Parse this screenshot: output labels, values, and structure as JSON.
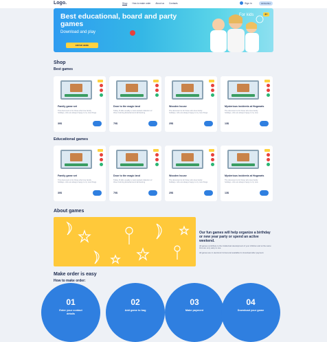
{
  "header": {
    "logo": "Logo.",
    "nav": [
      "Shop",
      "How to make order",
      "About us",
      "Contacts"
    ],
    "signin": "Sign in",
    "lang": "ENGLISH"
  },
  "hero": {
    "title": "Best educational, board and party games",
    "subtitle": "Download and play",
    "button": "ENTER HERE",
    "for_kids": "For kids",
    "age": "6+"
  },
  "shop": {
    "title": "Shop",
    "best_title": "Best games",
    "edu_title": "Educational games",
    "best": [
      {
        "name": "Family game set",
        "desc": "This document is for those who love family holidays, who are always happy to try new things",
        "price": "30$"
      },
      {
        "name": "Door to the magic land",
        "desc": "Today, fit kids usually a most wanted collection of three Coloring Entertainment Enhancing",
        "price": "70$"
      },
      {
        "name": "Wooden house",
        "desc": "The document is for those who love family holidays, who are always happy to try new things",
        "price": "25$"
      },
      {
        "name": "Mysterious incidents at Hogwarts",
        "desc": "The document is for those who love family holidays, who are always happy to try new",
        "price": "13$"
      }
    ],
    "edu": [
      {
        "name": "Family game set",
        "desc": "This document is for those who love family holidays, who are always happy to try new things",
        "price": "30$"
      },
      {
        "name": "Door to the magic land",
        "desc": "Today, fit kids usually a most wanted collection of three Coloring Entertainment Enhancing",
        "price": "70$"
      },
      {
        "name": "Wooden house",
        "desc": "The document is for those who love family holidays, who are always happy to try new things",
        "price": "25$"
      },
      {
        "name": "Mysterious incidents at Hogwarts",
        "desc": "The document is for those who love family holidays, who are always happy to try new",
        "price": "13$"
      }
    ]
  },
  "about": {
    "title": "About games",
    "heading": "Our fun games will help organize a birthday or new year party or spend an active weekend.",
    "p1": "All games contribute to the intellectual development of your children and at the same time are very easy to use.",
    "p2": "All games are in electronic format and available for download after payment."
  },
  "order": {
    "title": "Make order is easy",
    "subtitle": "How to make order:",
    "steps": [
      {
        "num": "01",
        "text": "Enter your contact details"
      },
      {
        "num": "02",
        "text": "Add game to bag"
      },
      {
        "num": "03",
        "text": "Make payment"
      },
      {
        "num": "04",
        "text": "Download your game"
      }
    ]
  },
  "colors": {
    "primary": "#2f7fe0",
    "accent": "#ffd23f",
    "danger": "#e8413c"
  }
}
